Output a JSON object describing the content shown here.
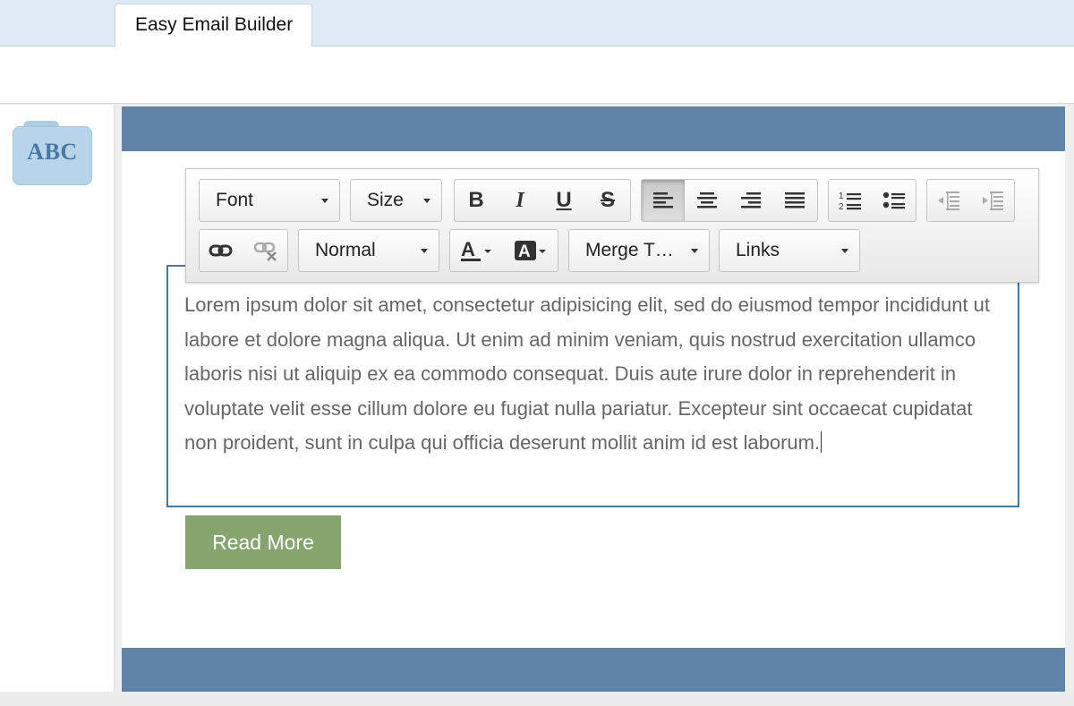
{
  "tab": {
    "title": "Easy Email Builder"
  },
  "sidebar": {
    "block_label": "ABC"
  },
  "toolbar": {
    "font_label": "Font",
    "size_label": "Size",
    "format_label": "Normal",
    "merge_label": "Merge T…",
    "links_label": "Links",
    "bold_glyph": "B",
    "italic_glyph": "I",
    "underline_glyph": "U",
    "strike_glyph": "S",
    "active_alignment": "align-left"
  },
  "content": {
    "body_text": "Lorem ipsum dolor sit amet, consectetur adipisicing elit, sed do eiusmod tempor incididunt ut labore et dolore magna aliqua. Ut enim ad minim veniam, quis nostrud exercitation ullamco laboris nisi ut aliquip ex ea commodo consequat. Duis aute irure dolor in reprehenderit in voluptate velit esse cillum dolore eu fugiat nulla pariatur. Excepteur sint occaecat cupidatat non proident, sunt in culpa qui officia deserunt mollit anim id est laborum.",
    "button_label": "Read More"
  },
  "colors": {
    "header_bar": "#5f84a8",
    "button": "#86a56e",
    "editor_border": "#45789e"
  }
}
